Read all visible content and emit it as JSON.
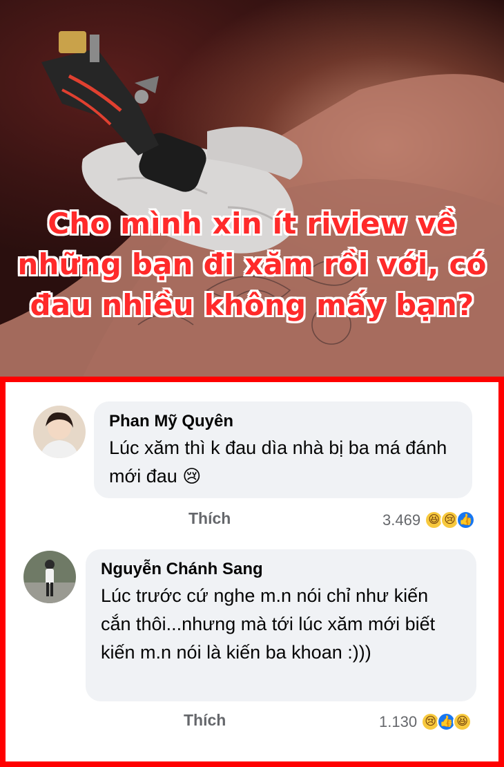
{
  "post": {
    "title": "Cho mình xin ít riview về những bạn đi xăm rồi với, có đau nhiều không mấy bạn?"
  },
  "comments": [
    {
      "author": "Phan Mỹ Quyên",
      "text": "Lúc xăm thì k đau dìa nhà bị ba má đánh mới đau",
      "emoji": "😢",
      "like_label": "Thích",
      "reaction_count": "3.469",
      "reactions": [
        "haha-icon",
        "sad-icon",
        "like-icon"
      ]
    },
    {
      "author": "Nguyễn Chánh Sang",
      "text": "Lúc trước cứ nghe m.n nói chỉ như kiến cắn thôi...nhưng mà tới lúc xăm mới biết kiến m.n nói là kiến ba khoan :)))",
      "like_label": "Thích",
      "reaction_count": "1.130",
      "reactions": [
        "sad-icon",
        "like-icon",
        "haha-icon"
      ]
    }
  ],
  "colors": {
    "frame": "#ff0000",
    "title": "#ff2a2a",
    "bubble": "#f0f2f5",
    "like_blue": "#1877f2"
  }
}
